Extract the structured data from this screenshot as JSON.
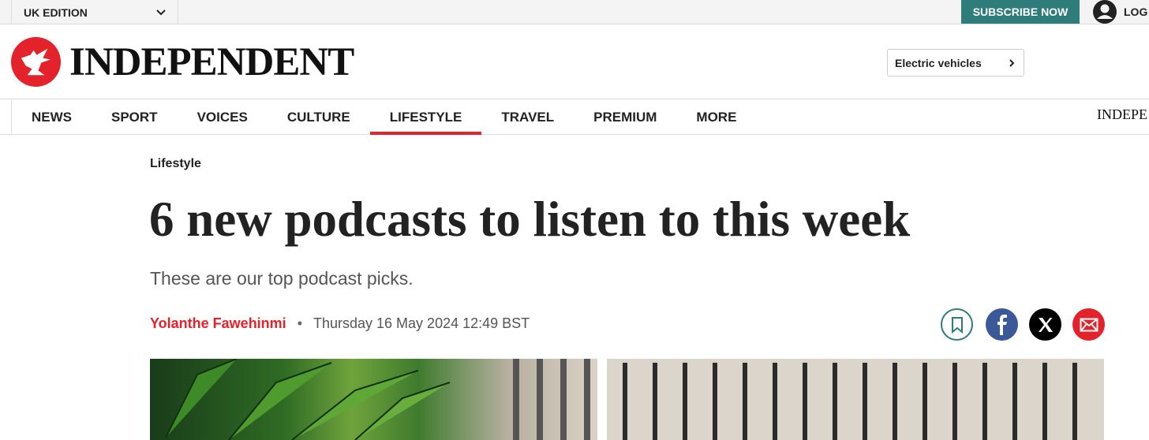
{
  "topbar": {
    "edition": "UK EDITION",
    "subscribe": "SUBSCRIBE NOW",
    "login": "LOG"
  },
  "header": {
    "wordmark": "INDEPENDENT",
    "ev_button": "Electric vehicles"
  },
  "nav": {
    "items": [
      {
        "label": "NEWS"
      },
      {
        "label": "SPORT"
      },
      {
        "label": "VOICES"
      },
      {
        "label": "CULTURE"
      },
      {
        "label": "LIFESTYLE",
        "active": true
      },
      {
        "label": "TRAVEL"
      },
      {
        "label": "PREMIUM"
      },
      {
        "label": "MORE"
      }
    ],
    "right_logo": "INDEPE"
  },
  "article": {
    "section": "Lifestyle",
    "headline": "6 new podcasts to listen to this week",
    "standfirst": "These are our top podcast picks.",
    "author": "Yolanthe Fawehinmi",
    "separator": "•",
    "date": "Thursday 16 May 2024 12:49 BST"
  },
  "colors": {
    "accent": "#e4222b",
    "teal": "#2e7d7a",
    "facebook": "#3b5998"
  },
  "icons": [
    "chevron-down-icon",
    "user-icon",
    "eagle-logo-icon",
    "chevron-right-icon",
    "bookmark-icon",
    "facebook-icon",
    "x-icon",
    "mail-icon"
  ]
}
